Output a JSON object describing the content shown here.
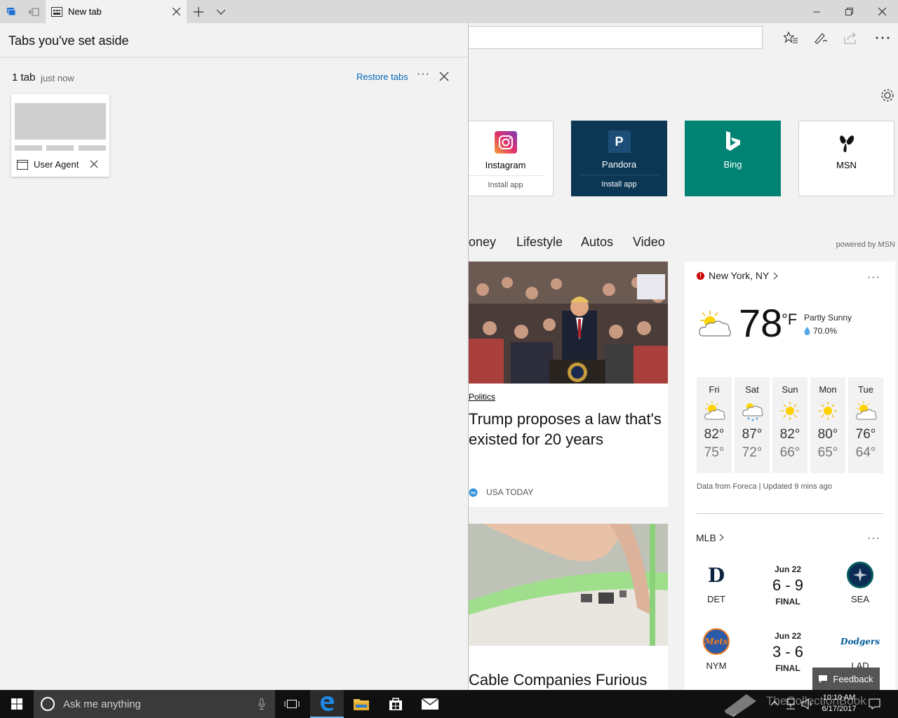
{
  "tab": {
    "title": "New tab"
  },
  "panel": {
    "title": "Tabs you've set aside",
    "group": {
      "count": "1 tab",
      "time": "just now",
      "restore_label": "Restore tabs",
      "more": "···",
      "tabs": [
        {
          "label": "User Agent"
        }
      ]
    }
  },
  "page": {
    "tiles": [
      {
        "name": "Instagram",
        "install": "Install app",
        "icon": "instagram-icon"
      },
      {
        "name": "Pandora",
        "install": "Install app",
        "icon": "pandora-icon",
        "glyph": "P",
        "bg": "#0b3654"
      },
      {
        "name": "Bing",
        "install": "",
        "icon": "bing-icon",
        "bg": "#008373"
      },
      {
        "name": "MSN",
        "install": "",
        "icon": "msn-icon"
      }
    ],
    "categories": [
      "oney",
      "Lifestyle",
      "Autos",
      "Video"
    ],
    "powered_by": "powered by MSN",
    "news": [
      {
        "category": "Politics",
        "headline": "Trump proposes a law that's existed for 20 years",
        "source": "USA TODAY"
      },
      {
        "headline": "Cable Companies Furious"
      }
    ],
    "weather": {
      "location": "New York, NY",
      "more": "···",
      "temp": "78",
      "unit": "°F",
      "condition": "Partly Sunny",
      "humidity": "70.0%",
      "forecast": [
        {
          "day": "Fri",
          "hi": "82°",
          "lo": "75°",
          "icon": "partly-sunny-icon"
        },
        {
          "day": "Sat",
          "hi": "87°",
          "lo": "72°",
          "icon": "rain-icon"
        },
        {
          "day": "Sun",
          "hi": "82°",
          "lo": "66°",
          "icon": "sunny-icon"
        },
        {
          "day": "Mon",
          "hi": "80°",
          "lo": "65°",
          "icon": "sunny-icon"
        },
        {
          "day": "Tue",
          "hi": "76°",
          "lo": "64°",
          "icon": "partly-sunny-icon"
        }
      ],
      "source": "Data from Foreca | Updated 9 mins ago"
    },
    "mlb": {
      "title": "MLB",
      "more": "···",
      "games": [
        {
          "date": "Jun 22",
          "score": "6 - 9",
          "status": "FINAL",
          "home": "DET",
          "away": "SEA"
        },
        {
          "date": "Jun 22",
          "score": "3 - 6",
          "status": "FINAL",
          "home": "NYM",
          "away": "LAD"
        }
      ]
    },
    "feedback": "Feedback"
  },
  "taskbar": {
    "search_placeholder": "Ask me anything",
    "time": "10:10 AM",
    "date": "6/17/2017",
    "watermark": "TheCollectionBook"
  },
  "colors": {
    "accent": "#0067b8",
    "edge_blue": "#1e88e5",
    "bing": "#008373",
    "pandora": "#0b3654"
  }
}
